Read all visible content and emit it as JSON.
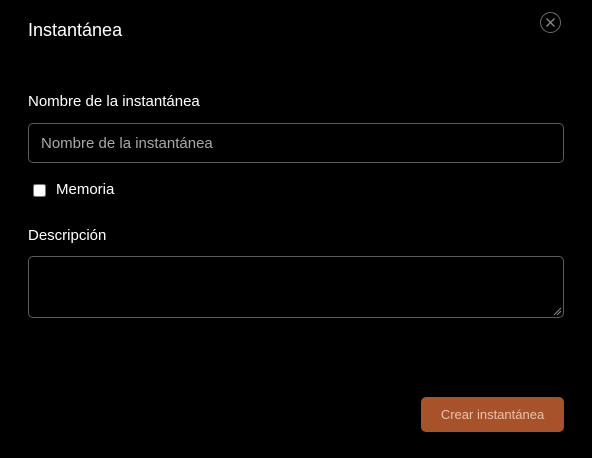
{
  "dialog": {
    "title": "Instantánea",
    "close_icon": "close-icon"
  },
  "form": {
    "name_label": "Nombre de la instantánea",
    "name_placeholder": "Nombre de la instantánea",
    "name_value": "",
    "memory_label": "Memoria",
    "memory_checked": false,
    "description_label": "Descripción",
    "description_value": ""
  },
  "actions": {
    "create_label": "Crear instantánea"
  },
  "colors": {
    "background": "#000000",
    "accent": "#a8522b",
    "text": "#ffffff",
    "input_border": "#5a5a5a"
  }
}
